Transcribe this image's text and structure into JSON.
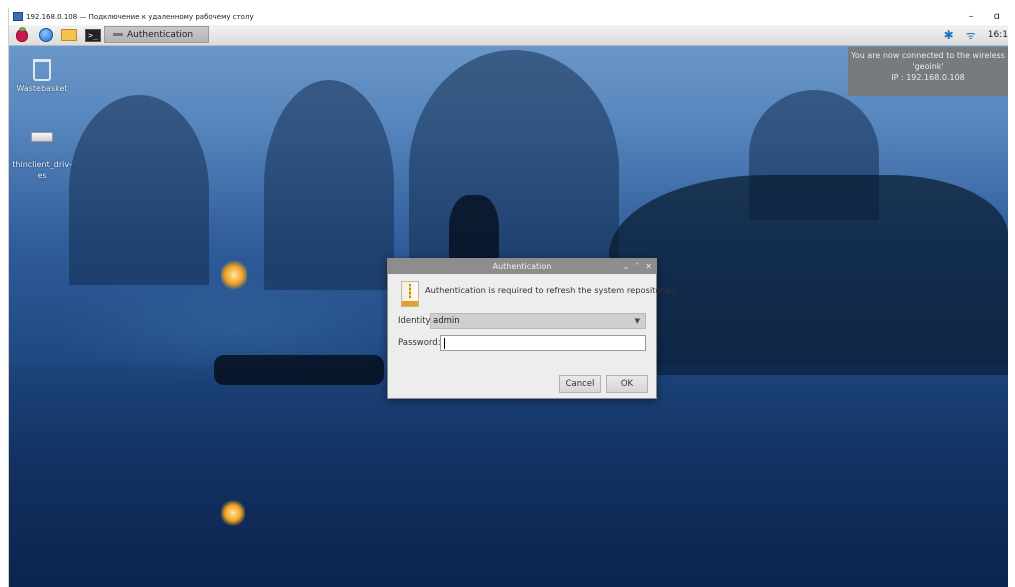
{
  "rdp_window": {
    "title": "192.168.0.108 — Подключение к удаленному рабочему столу",
    "minimize_label": "–",
    "restore_label": "ɑ"
  },
  "panel": {
    "icons": [
      "raspberry-menu-icon",
      "globe-icon",
      "folder-icon",
      "terminal-icon"
    ],
    "terminal_glyph": ">_",
    "taskbar_item_label": "Authentication",
    "clock": "16:1",
    "bluetooth_glyph": "✱",
    "wifi_glyph": "ᯤ"
  },
  "notification": {
    "line1": "You are now connected to the wireless netw",
    "line2": "'geoink'",
    "line3": "IP : 192.168.0.108"
  },
  "desktop_icons": [
    {
      "label": "Wastebasket"
    },
    {
      "label": "thinclient_driv-\nes"
    }
  ],
  "dialog": {
    "title": "Authentication",
    "controls": [
      "⌄",
      "˄",
      "✕"
    ],
    "message": "Authentication is required to refresh the system repositories",
    "identity_label": "Identity:",
    "identity_value": "admin",
    "password_label": "Password:",
    "password_value": "",
    "cancel_label": "Cancel",
    "ok_label": "OK"
  }
}
